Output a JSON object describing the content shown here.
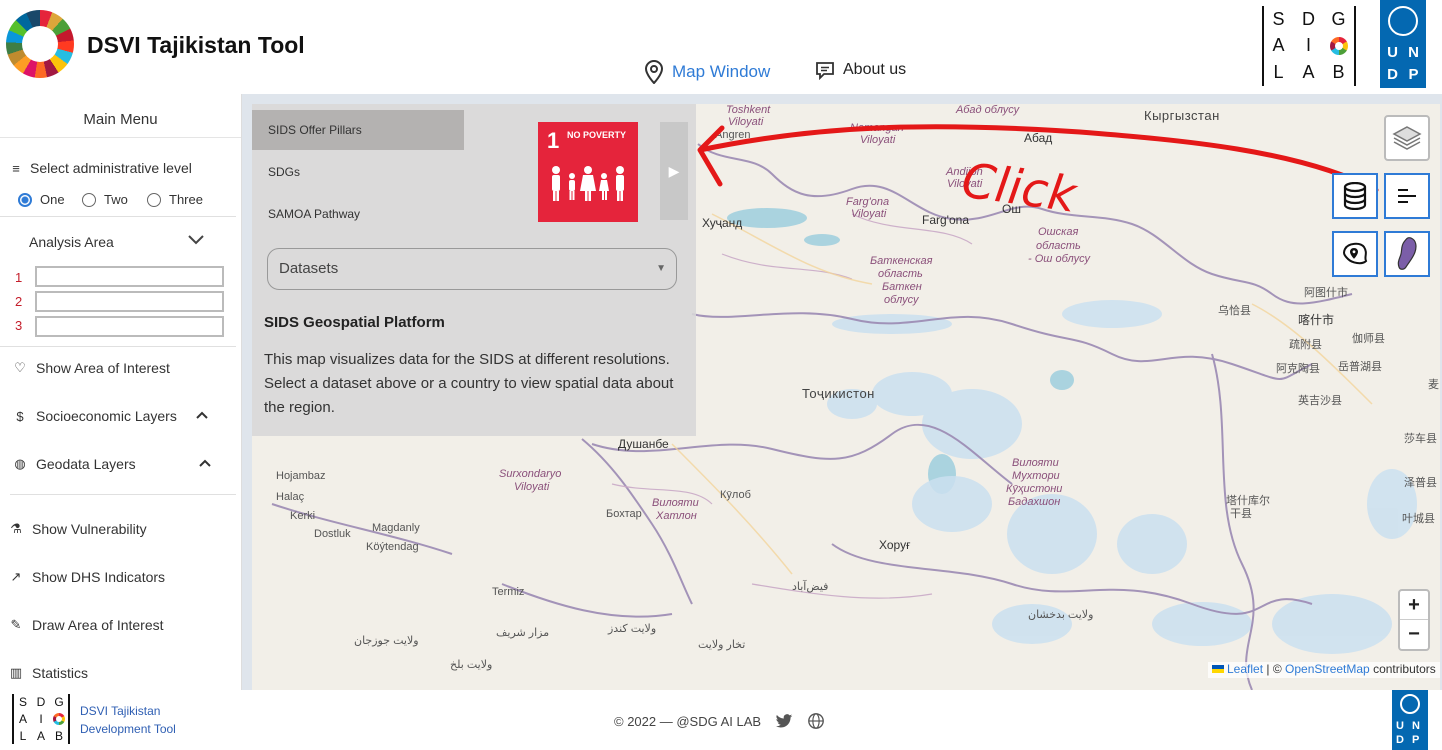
{
  "header": {
    "title": "DSVI Tajikistan Tool",
    "nav": {
      "map_window": "Map Window",
      "about": "About us"
    },
    "sdg_lab_letters": [
      "S",
      "D",
      "G",
      "A",
      "I",
      "",
      "L",
      "A",
      "B"
    ],
    "undp_letters": [
      "U",
      "N",
      "D",
      "P"
    ]
  },
  "sidebar": {
    "title": "Main Menu",
    "admin_level_label": "Select administrative level",
    "admin_levels": [
      "One",
      "Two",
      "Three"
    ],
    "selected_level": "One",
    "analysis_area_label": "Analysis Area",
    "analysis_rows": [
      "1",
      "2",
      "3"
    ],
    "items": {
      "area_of_interest": "Show Area of Interest",
      "socioeconomic": "Socioeconomic Layers",
      "geodata": "Geodata Layers",
      "vulnerability": "Show Vulnerability",
      "dhs": "Show DHS Indicators",
      "draw": "Draw Area of Interest",
      "statistics": "Statistics"
    }
  },
  "overlay": {
    "tabs": [
      "SIDS Offer Pillars",
      "SDGs",
      "SAMOA Pathway"
    ],
    "selected_tab": "SIDS Offer Pillars",
    "sdg_tile": {
      "number": "1",
      "text": "NO POVERTY",
      "color": "#e5243b"
    },
    "datasets_placeholder": "Datasets",
    "heading": "SIDS Geospatial Platform",
    "description": "This map visualizes data for the SIDS at different resolutions. Select a dataset above or a country to view spatial data about the region."
  },
  "map": {
    "labels": {
      "toshkent": "Toshkent",
      "viloyati1": "Viloyati",
      "angren": "Angren",
      "namangan": "Namangan",
      "viloyati2": "Viloyati",
      "abad_oblusu": "Абад облусу",
      "abad": "Абад",
      "kyrgyzstan": "Кыргызстан",
      "andijon": "Andijon",
      "viloyati3": "Viloyati",
      "fargona_v": "Farg'ona",
      "viloyati4": "Viloyati",
      "fargona": "Farg'ona",
      "osh": "Ош",
      "khujand": "Хуҷанд",
      "osh_oblast1": "Ошская",
      "osh_oblast2": "область",
      "osh_oblast3": "- Ош облусу",
      "batken1": "Баткенская",
      "batken2": "область",
      "batken3": "Баткен",
      "batken4": "облусу",
      "artux": "阿图什市",
      "wuqia": "乌恰县",
      "kashgar": "喀什市",
      "shufu": "疏附县",
      "jiashi": "伽师县",
      "akto": "阿克陶县",
      "yuepuhu": "岳普湖县",
      "yengisar": "英吉沙县",
      "tojikiston": "Тоҷикистон",
      "dushanbe": "Душанбе",
      "hojambaz": "Hojambaz",
      "halac": "Halaç",
      "kerki": "Kerki",
      "magdanly": "Magdanly",
      "dostluk": "Dostluk",
      "koytendag": "Köýtendag",
      "surxon1": "Surxondaryo",
      "surxon2": "Viloyati",
      "khatlon1": "Вилояти",
      "khatlon2": "Хатлон",
      "kulob": "Кӯлоб",
      "bokhtar": "Бохтар",
      "gbao1": "Вилояти",
      "gbao2": "Мухтори",
      "gbao3": "Кӯҳистони",
      "gbao4": "Бадахшон",
      "khorugh": "Хоруғ",
      "termiz": "Termiz",
      "fayzabad": "فیض‌آباد",
      "mazar": "مزار شریف",
      "jowzjan": "ولایت جوزجان",
      "kunduz": "ولایت کندز",
      "balkh": "ولایت بلخ",
      "takhar": "تخار ولایت",
      "badakhshan": "ولایت بدخشان",
      "shache": "莎车县",
      "zepu": "泽普县",
      "tashkurgan1": "塔什库尔",
      "tashkurgan2": "干县",
      "yecheng": "叶城县",
      "mai": "麦"
    },
    "annotation": "Click",
    "zoom_in": "+",
    "zoom_out": "−",
    "attribution": {
      "leaflet": "Leaflet",
      "sep": "| ©",
      "osm": "OpenStreetMap",
      "contrib": "contributors"
    }
  },
  "footer": {
    "lab_letters": [
      "S",
      "D",
      "G",
      "A",
      "I",
      "",
      "L",
      "A",
      "B"
    ],
    "name_line1": "DSVI Tajikistan",
    "name_line2": "Development Tool",
    "copyright": "© 2022 — @SDG AI LAB"
  }
}
